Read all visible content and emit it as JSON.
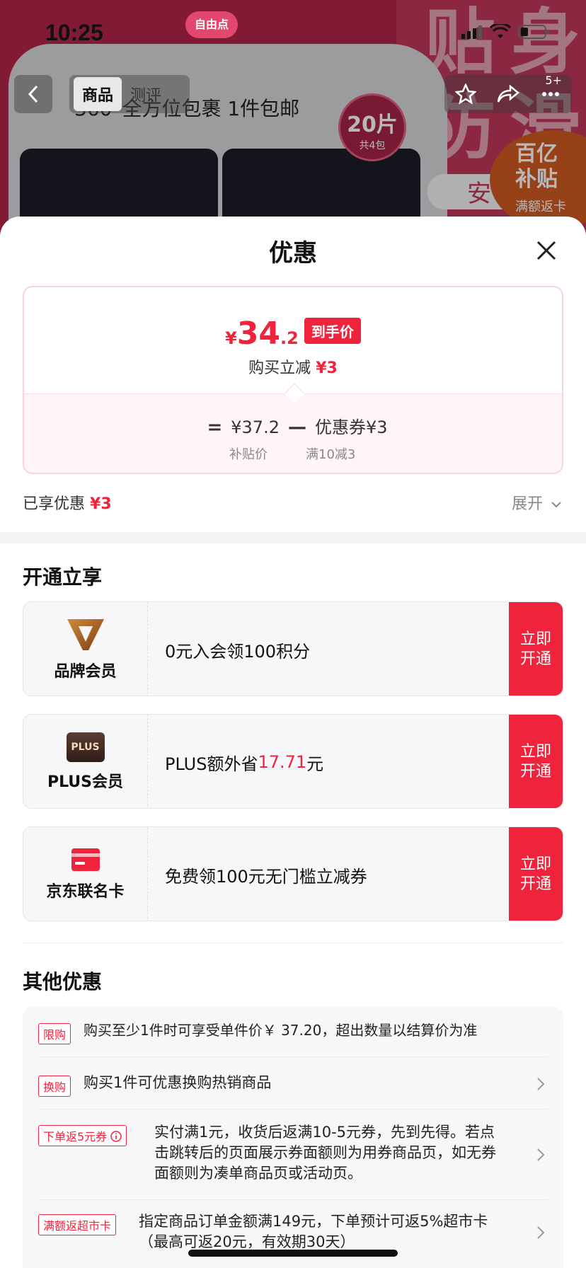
{
  "status_bar": {
    "time": "10:25"
  },
  "background": {
    "app_logo_text": "自由点",
    "product_title": "360°全方位包裹  1件包邮",
    "pack_badge": {
      "count": "20片",
      "sub": "共4包"
    },
    "banner_chars": [
      "贴",
      "身",
      "防",
      "滑"
    ],
    "banner_pill": "安",
    "subsidy_badge": {
      "line1": "百亿",
      "line2": "补贴",
      "line3": "满额返卡"
    },
    "nav": {
      "tabs": [
        "商品",
        "测评"
      ],
      "more_count": "5+"
    }
  },
  "sheet": {
    "title": "优惠",
    "price_card": {
      "currency": "¥",
      "final_int": "34",
      "final_dec": ".2",
      "final_tag": "到手价",
      "instant_label": "购买立减",
      "instant_value": "¥3",
      "formula": {
        "eq": "=",
        "base": "¥37.2",
        "minus": "—",
        "coupon": "优惠券¥3",
        "base_sub": "补贴价",
        "coupon_sub": "满10减3"
      }
    },
    "enjoyed": {
      "label": "已享优惠",
      "value": "¥3",
      "expand": "展开"
    },
    "open_section": {
      "title": "开通立享",
      "cards": [
        {
          "name": "品牌会员",
          "icon": "brand-v-icon",
          "desc": "0元入会领100积分",
          "cta": "立即开通"
        },
        {
          "name": "PLUS会员",
          "icon": "plus-icon",
          "icon_text": "PLUS",
          "desc_pre": "PLUS额外省",
          "desc_red": "17.71",
          "desc_post": "元",
          "cta": "立即开通"
        },
        {
          "name": "京东联名卡",
          "icon": "card-icon",
          "desc": "免费领100元无门槛立减券",
          "cta": "立即开通"
        }
      ]
    },
    "other_section": {
      "title": "其他优惠",
      "items": [
        {
          "tag": "限购",
          "text": "购买至少1件时可享受单件价￥ 37.20，超出数量以结算价为准"
        },
        {
          "tag": "换购",
          "text": "购买1件可优惠换购热销商品"
        },
        {
          "tag": "下单返5元券",
          "text": "实付满1元，收货后返满10-5元券，先到先得。若点击跳转后的页面展示券面额则为用券商品页，如无券面额则为凑单商品页或活动页。"
        },
        {
          "tag": "满额返超市卡",
          "text": "指定商品订单金额满149元，下单预计可返5%超市卡（最高可返20元，有效期30天）"
        }
      ]
    }
  },
  "colors": {
    "accent": "#f0233c",
    "card_bg": "#f7f7fa",
    "bg_magenta": "#b3244a"
  }
}
